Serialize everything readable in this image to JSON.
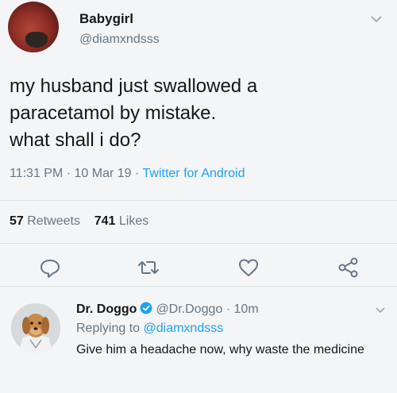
{
  "tweet": {
    "display_name": "Babygirl",
    "handle": "@diamxndsss",
    "text": "my husband just swallowed a\nparacetamol by mistake.\nwhat shall i do?",
    "time": "11:31 PM",
    "date": "10 Mar 19",
    "source": "Twitter for Android",
    "retweets_count": "57",
    "retweets_label": "Retweets",
    "likes_count": "741",
    "likes_label": "Likes"
  },
  "icons": {
    "reply": "reply-icon",
    "retweet": "retweet-icon",
    "like": "heart-icon",
    "share": "share-icon",
    "chevron": "chevron-down-icon",
    "verified": "verified-badge-icon"
  },
  "reply_tweet": {
    "display_name": "Dr. Doggo",
    "handle": "@Dr.Doggo",
    "time": "10m",
    "replying_prefix": "Replying to",
    "replying_to": "@diamxndsss",
    "text": "Give him a headache now, why waste the medicine"
  },
  "colors": {
    "accent": "#1da1f2",
    "secondary_text": "#657786",
    "primary_text": "#14171a",
    "background": "#f4f5f6"
  }
}
